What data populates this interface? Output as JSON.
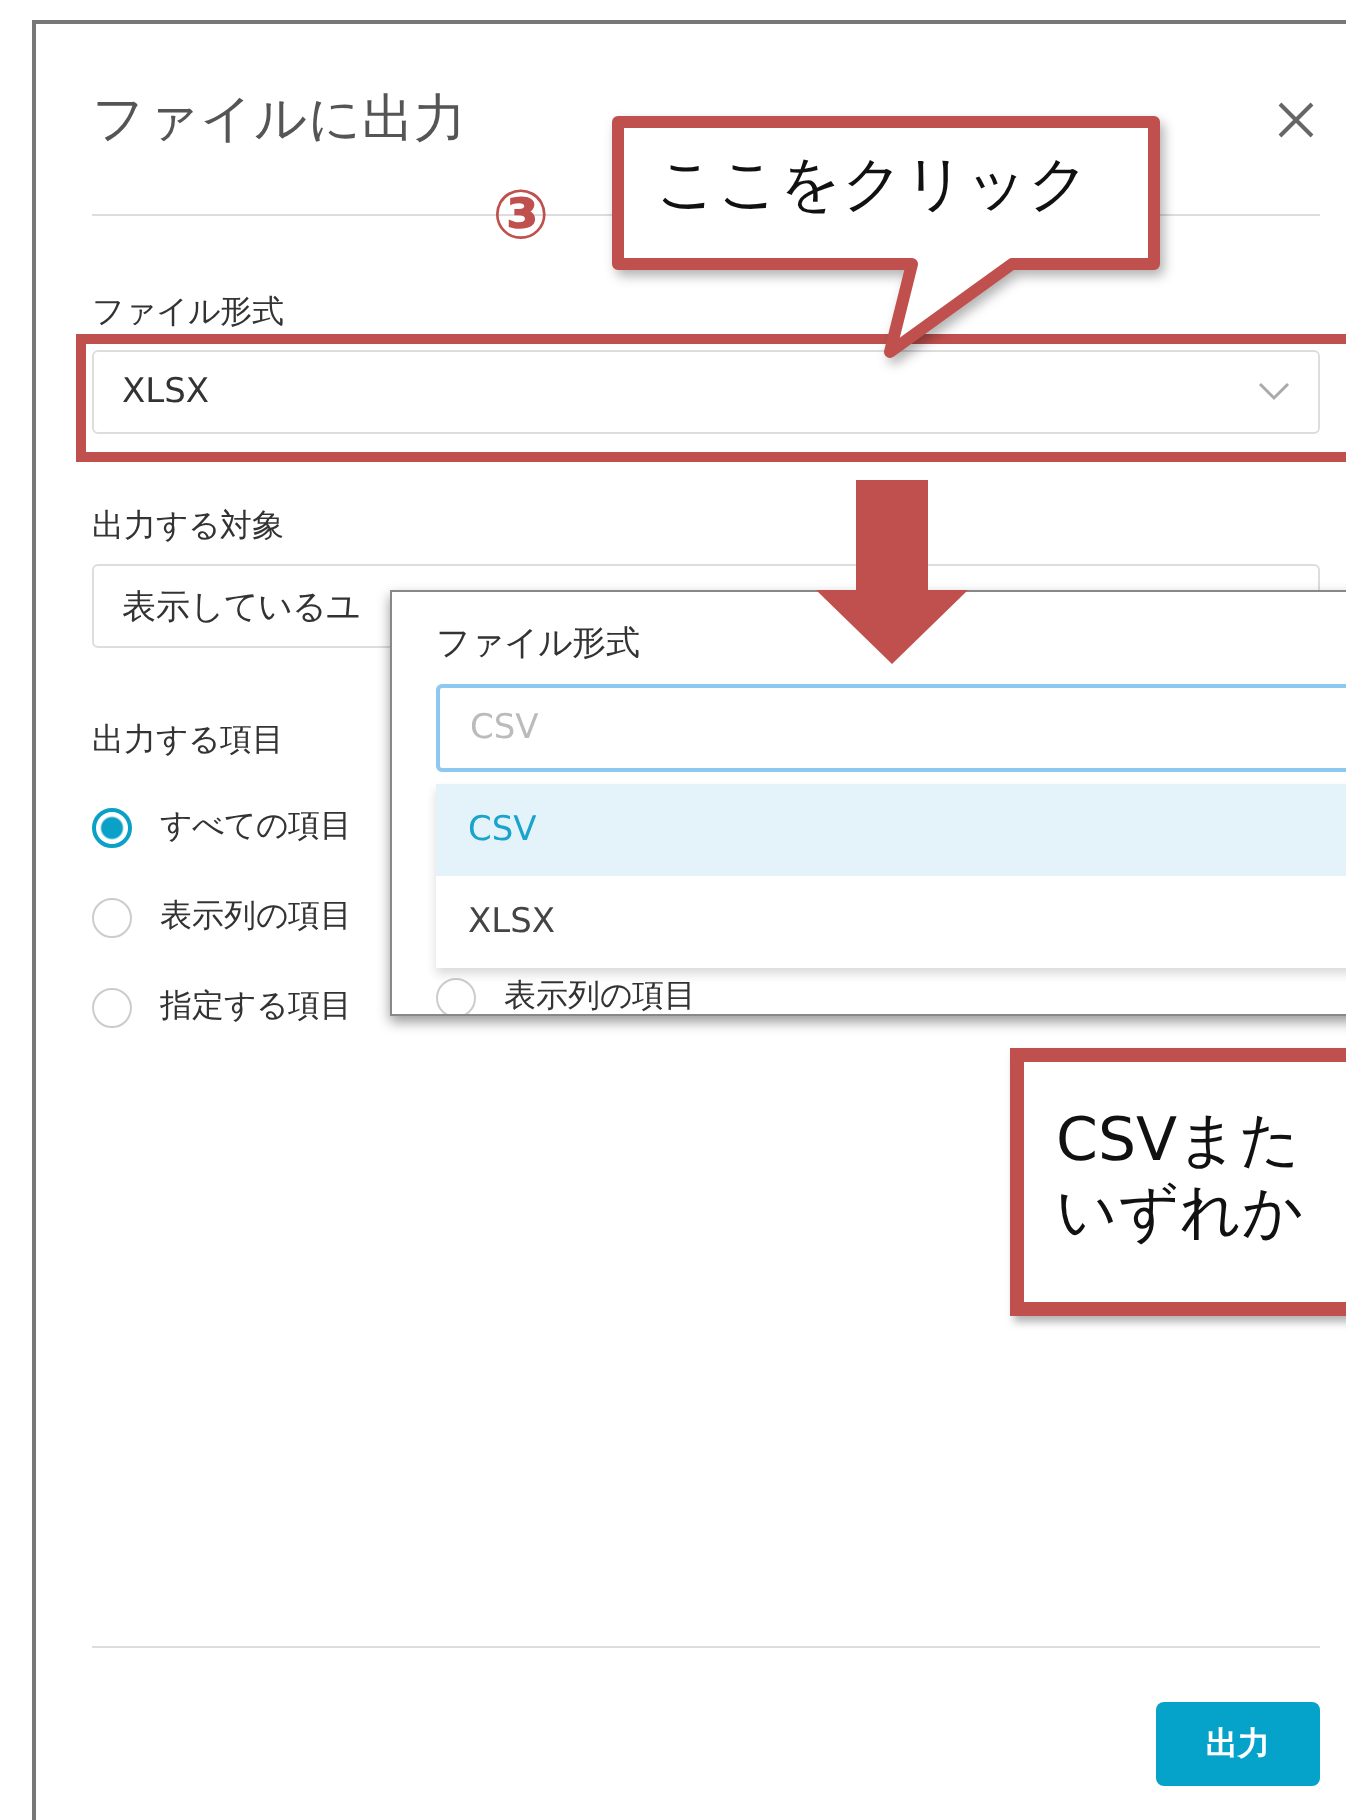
{
  "dialog": {
    "title": "ファイルに出力",
    "file_format": {
      "label": "ファイル形式",
      "value": "XLSX"
    },
    "target": {
      "label": "出力する対象",
      "value": "表示しているユ"
    },
    "items": {
      "label": "出力する項目",
      "options": [
        {
          "label": "すべての項目",
          "selected": true
        },
        {
          "label": "表示列の項目",
          "selected": false
        },
        {
          "label": "指定する項目",
          "selected": false
        }
      ]
    },
    "submit_button": "出力"
  },
  "dropdown": {
    "label": "ファイル形式",
    "placeholder": "CSV",
    "options": [
      {
        "label": "CSV",
        "selected": true
      },
      {
        "label": "XLSX",
        "selected": false
      }
    ],
    "partly_hidden_option": {
      "label": "表示列の項目",
      "selected": false
    }
  },
  "annotations": {
    "step": "③",
    "callout": "ここをクリック",
    "note_lines": [
      "CSVまた",
      "いずれか"
    ]
  }
}
